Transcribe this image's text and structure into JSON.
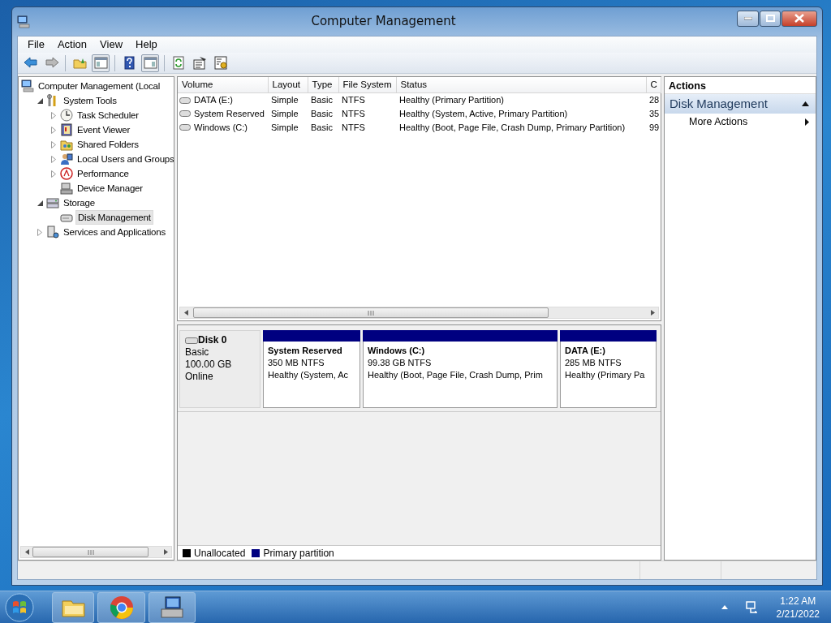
{
  "window": {
    "title": "Computer Management"
  },
  "menu": [
    "File",
    "Action",
    "View",
    "Help"
  ],
  "tree": [
    {
      "label": "Computer Management (Local",
      "kind": "root",
      "selected": false,
      "children": [
        {
          "label": "System Tools",
          "kind": "node",
          "expanded": true,
          "selected": false,
          "children": [
            {
              "label": "Task Scheduler",
              "kind": "node",
              "expanded": false,
              "selected": false
            },
            {
              "label": "Event Viewer",
              "kind": "node",
              "expanded": false,
              "selected": false
            },
            {
              "label": "Shared Folders",
              "kind": "node",
              "expanded": false,
              "selected": false
            },
            {
              "label": "Local Users and Groups",
              "kind": "node",
              "expanded": false,
              "selected": false
            },
            {
              "label": "Performance",
              "kind": "node",
              "expanded": false,
              "selected": false
            },
            {
              "label": "Device Manager",
              "kind": "leaf",
              "selected": false
            }
          ]
        },
        {
          "label": "Storage",
          "kind": "node",
          "expanded": true,
          "selected": false,
          "children": [
            {
              "label": "Disk Management",
              "kind": "leaf",
              "selected": true
            }
          ]
        },
        {
          "label": "Services and Applications",
          "kind": "node",
          "expanded": false,
          "selected": false
        }
      ]
    }
  ],
  "volumes": {
    "columns": [
      "Volume",
      "Layout",
      "Type",
      "File System",
      "Status",
      "C"
    ],
    "rows": [
      {
        "volume": "DATA (E:)",
        "layout": "Simple",
        "type": "Basic",
        "file_system": "NTFS",
        "status": "Healthy (Primary Partition)",
        "column_6": "28"
      },
      {
        "volume": "System Reserved",
        "layout": "Simple",
        "type": "Basic",
        "file_system": "NTFS",
        "status": "Healthy (System, Active, Primary Partition)",
        "column_6": "35"
      },
      {
        "volume": "Windows (C:)",
        "layout": "Simple",
        "type": "Basic",
        "file_system": "NTFS",
        "status": "Healthy (Boot, Page File, Crash Dump, Primary Partition)",
        "column_6": "99"
      }
    ]
  },
  "disk": {
    "name": "Disk 0",
    "type": "Basic",
    "size": "100.00 GB",
    "status": "Online",
    "partitions": [
      {
        "name": "System Reserved",
        "size": "350 MB NTFS",
        "status": "Healthy (System, Ac",
        "color": "#000080"
      },
      {
        "name": "Windows  (C:)",
        "size": "99.38 GB NTFS",
        "status": "Healthy (Boot, Page File, Crash Dump, Prim",
        "color": "#000080"
      },
      {
        "name": "DATA  (E:)",
        "size": "285 MB NTFS",
        "status": "Healthy (Primary Pa",
        "color": "#000080"
      }
    ]
  },
  "legend": [
    {
      "label": "Unallocated",
      "color": "#000000"
    },
    {
      "label": "Primary partition",
      "color": "#000080"
    }
  ],
  "actions": {
    "title": "Actions",
    "section": "Disk Management",
    "expanded": true,
    "items": [
      "More Actions"
    ]
  },
  "taskbar": {
    "time": "1:22 AM",
    "date": "2/21/2022"
  }
}
